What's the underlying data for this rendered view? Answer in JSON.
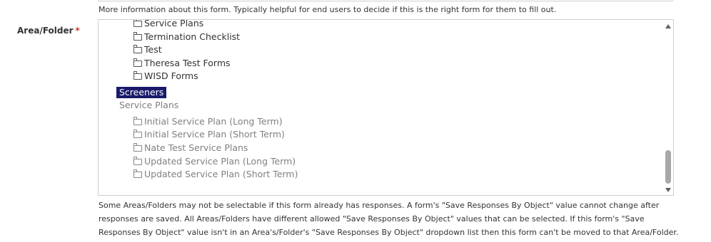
{
  "help_top": "More information about this form. Typically helpful for end users to decide if this is the right form for them to fill out.",
  "area_field": {
    "label": "Area/Folder",
    "required_marker": "*"
  },
  "list": {
    "top_items": [
      "Service Plans",
      "Termination Checklist",
      "Test",
      "Theresa Test Forms",
      "WISD Forms"
    ],
    "selected_group": "Screeners",
    "disabled_group": "Service Plans",
    "disabled_items": [
      "Initial Service Plan (Long Term)",
      "Initial Service Plan (Short Term)",
      "Nate Test Service Plans",
      "Updated Service Plan (Long Term)",
      "Updated Service Plan (Short Term)"
    ]
  },
  "help_bottom": "Some Areas/Folders may not be selectable if this form already has responses. A form's \"Save Responses By Object\" value cannot change after responses are saved. All Areas/Folders have different allowed \"Save Responses By Object\" values that can be selected. If this form's \"Save Responses By Object\" value isn't in an Area's/Folder's \"Save Responses By Object\" dropdown list then this form can't be moved to that Area/Folder.",
  "icons": {
    "folder": "folder-icon",
    "scroll_up": "chevron-up-icon",
    "scroll_down": "chevron-down-icon",
    "resize": "resize-grip-icon"
  },
  "colors": {
    "selected_bg": "#1a1a6b",
    "required": "#d9302c",
    "disabled_text": "#808080"
  }
}
